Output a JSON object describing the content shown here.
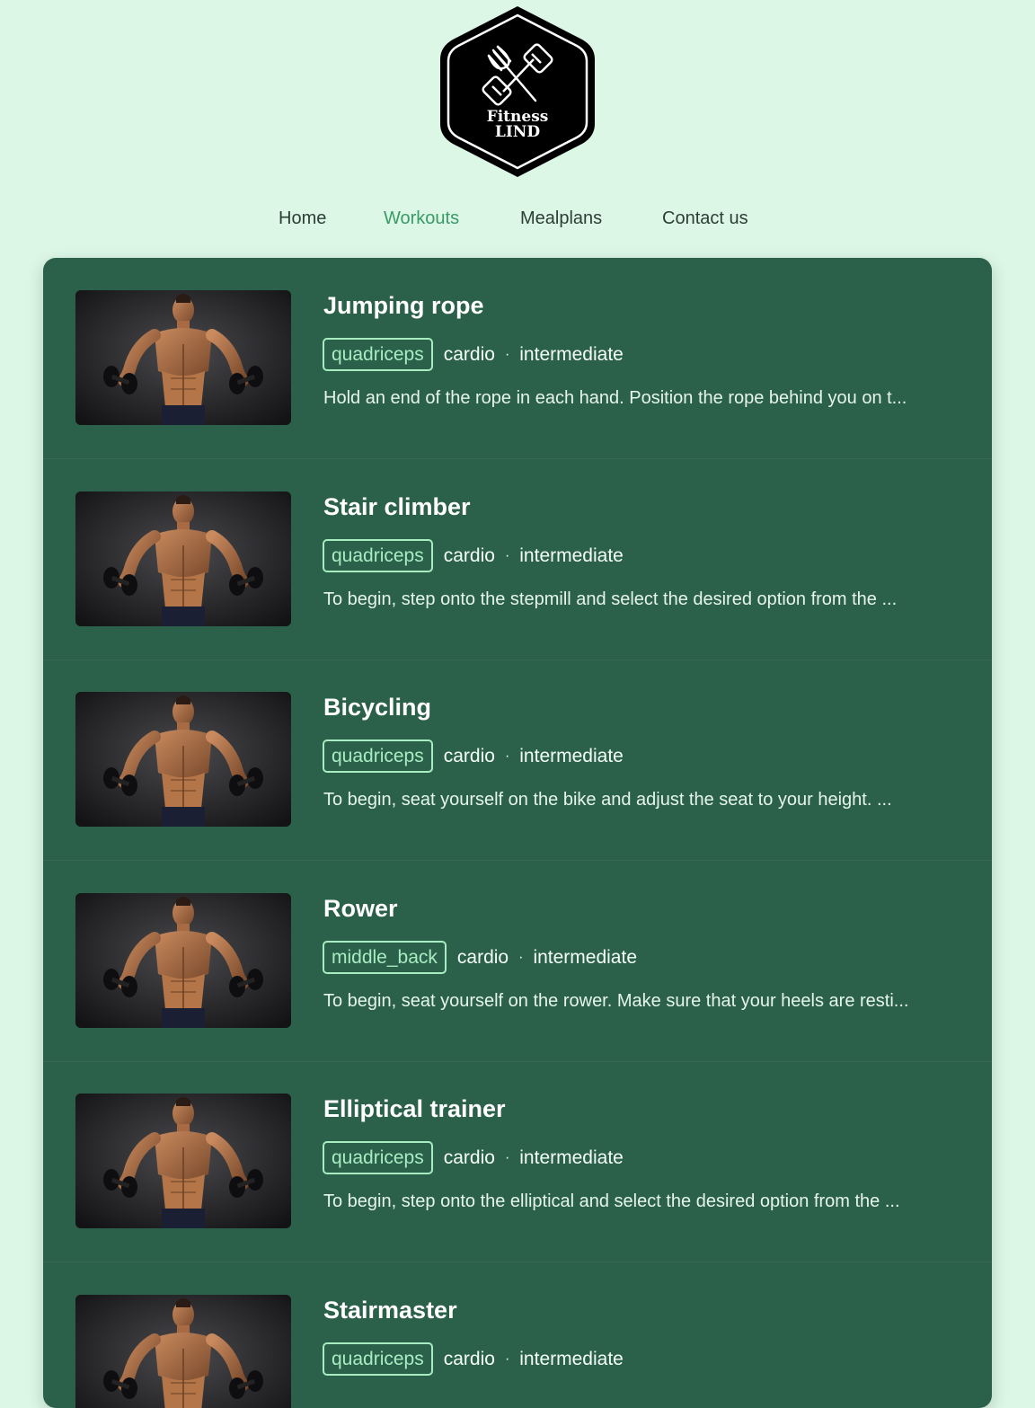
{
  "brand": {
    "logo_line1": "Fitness",
    "logo_line2": "LIND"
  },
  "nav": [
    {
      "label": "Home",
      "active": false
    },
    {
      "label": "Workouts",
      "active": true
    },
    {
      "label": "Mealplans",
      "active": false
    },
    {
      "label": "Contact us",
      "active": false
    }
  ],
  "workouts": [
    {
      "name": "Jumping rope",
      "muscle": "quadriceps",
      "type": "cardio",
      "level": "intermediate",
      "description": "Hold an end of the rope in each hand. Position the rope behind you on t..."
    },
    {
      "name": "Stair climber",
      "muscle": "quadriceps",
      "type": "cardio",
      "level": "intermediate",
      "description": "To begin, step onto the stepmill and select the desired option from the ..."
    },
    {
      "name": "Bicycling",
      "muscle": "quadriceps",
      "type": "cardio",
      "level": "intermediate",
      "description": "To begin, seat yourself on the bike and adjust the seat to your height. ..."
    },
    {
      "name": "Rower",
      "muscle": "middle_back",
      "type": "cardio",
      "level": "intermediate",
      "description": "To begin, seat yourself on the rower. Make sure that your heels are resti..."
    },
    {
      "name": "Elliptical trainer",
      "muscle": "quadriceps",
      "type": "cardio",
      "level": "intermediate",
      "description": "To begin, step onto the elliptical and select the desired option from the ..."
    },
    {
      "name": "Stairmaster",
      "muscle": "quadriceps",
      "type": "cardio",
      "level": "intermediate",
      "description": ""
    }
  ],
  "meta_separator": "·",
  "colors": {
    "page_background": "#dcf7e6",
    "panel_background": "#2b614a",
    "accent": "#3a9a68",
    "tag": "#a8ecc2"
  },
  "icons": {
    "logo": "fork-and-dumbbell-hexagon-logo",
    "thumbnail": "bodybuilder-with-dumbbells-photo"
  }
}
